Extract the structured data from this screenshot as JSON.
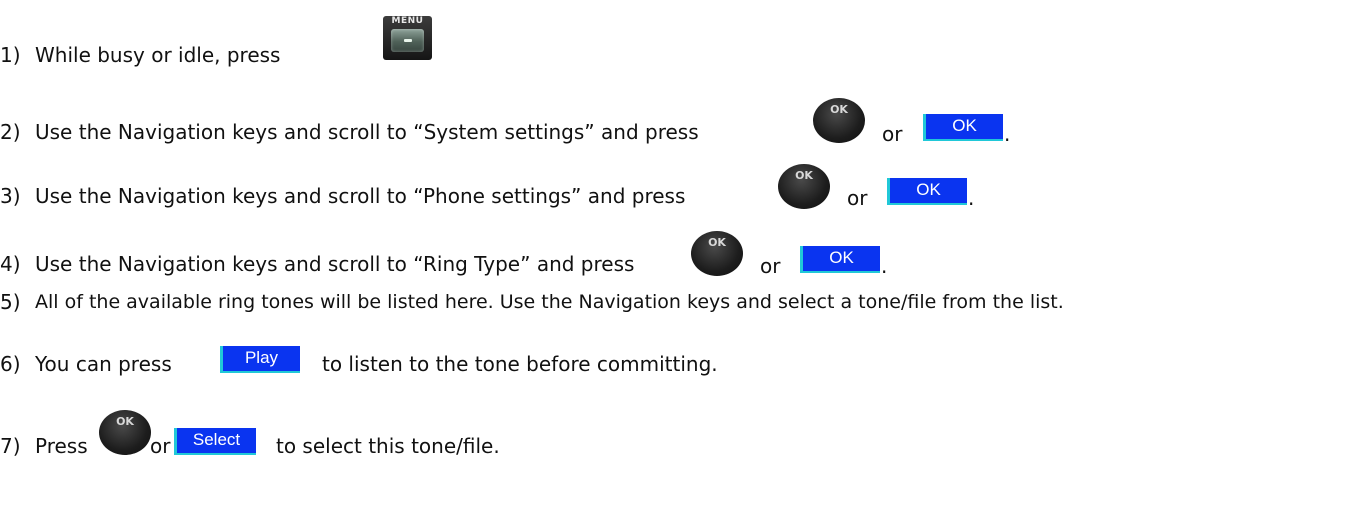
{
  "steps": [
    {
      "number": "1)",
      "text_before": "While busy or idle, press",
      "key": "MENU"
    },
    {
      "number": "2)",
      "text_before": "Use the Navigation keys and scroll to “System settings” and press",
      "or": "or",
      "softkey": "OK",
      "end": "."
    },
    {
      "number": "3)",
      "text_before": "Use the Navigation keys and scroll to “Phone settings” and press",
      "or": "or",
      "softkey": "OK",
      "end": "."
    },
    {
      "number": "4)",
      "text_before": "Use the Navigation keys and scroll to “Ring Type” and press",
      "or": "or",
      "softkey": "OK",
      "end": "."
    },
    {
      "number": "5)",
      "text_before": "All of the available ring tones will be listed here. Use the Navigation keys and select a tone/file from the list."
    },
    {
      "number": "6)",
      "text_before": "You can press",
      "softkey": "Play",
      "text_after": "to listen to the tone before committing."
    },
    {
      "number": "7)",
      "text_before": "Press",
      "or": "or",
      "softkey": "Select",
      "text_after": "to select this tone/file."
    }
  ],
  "ok_key_label": "OK",
  "colors": {
    "softkey_bg": "#0a34f0",
    "softkey_edge": "#20c8d8",
    "text": "#111111"
  }
}
